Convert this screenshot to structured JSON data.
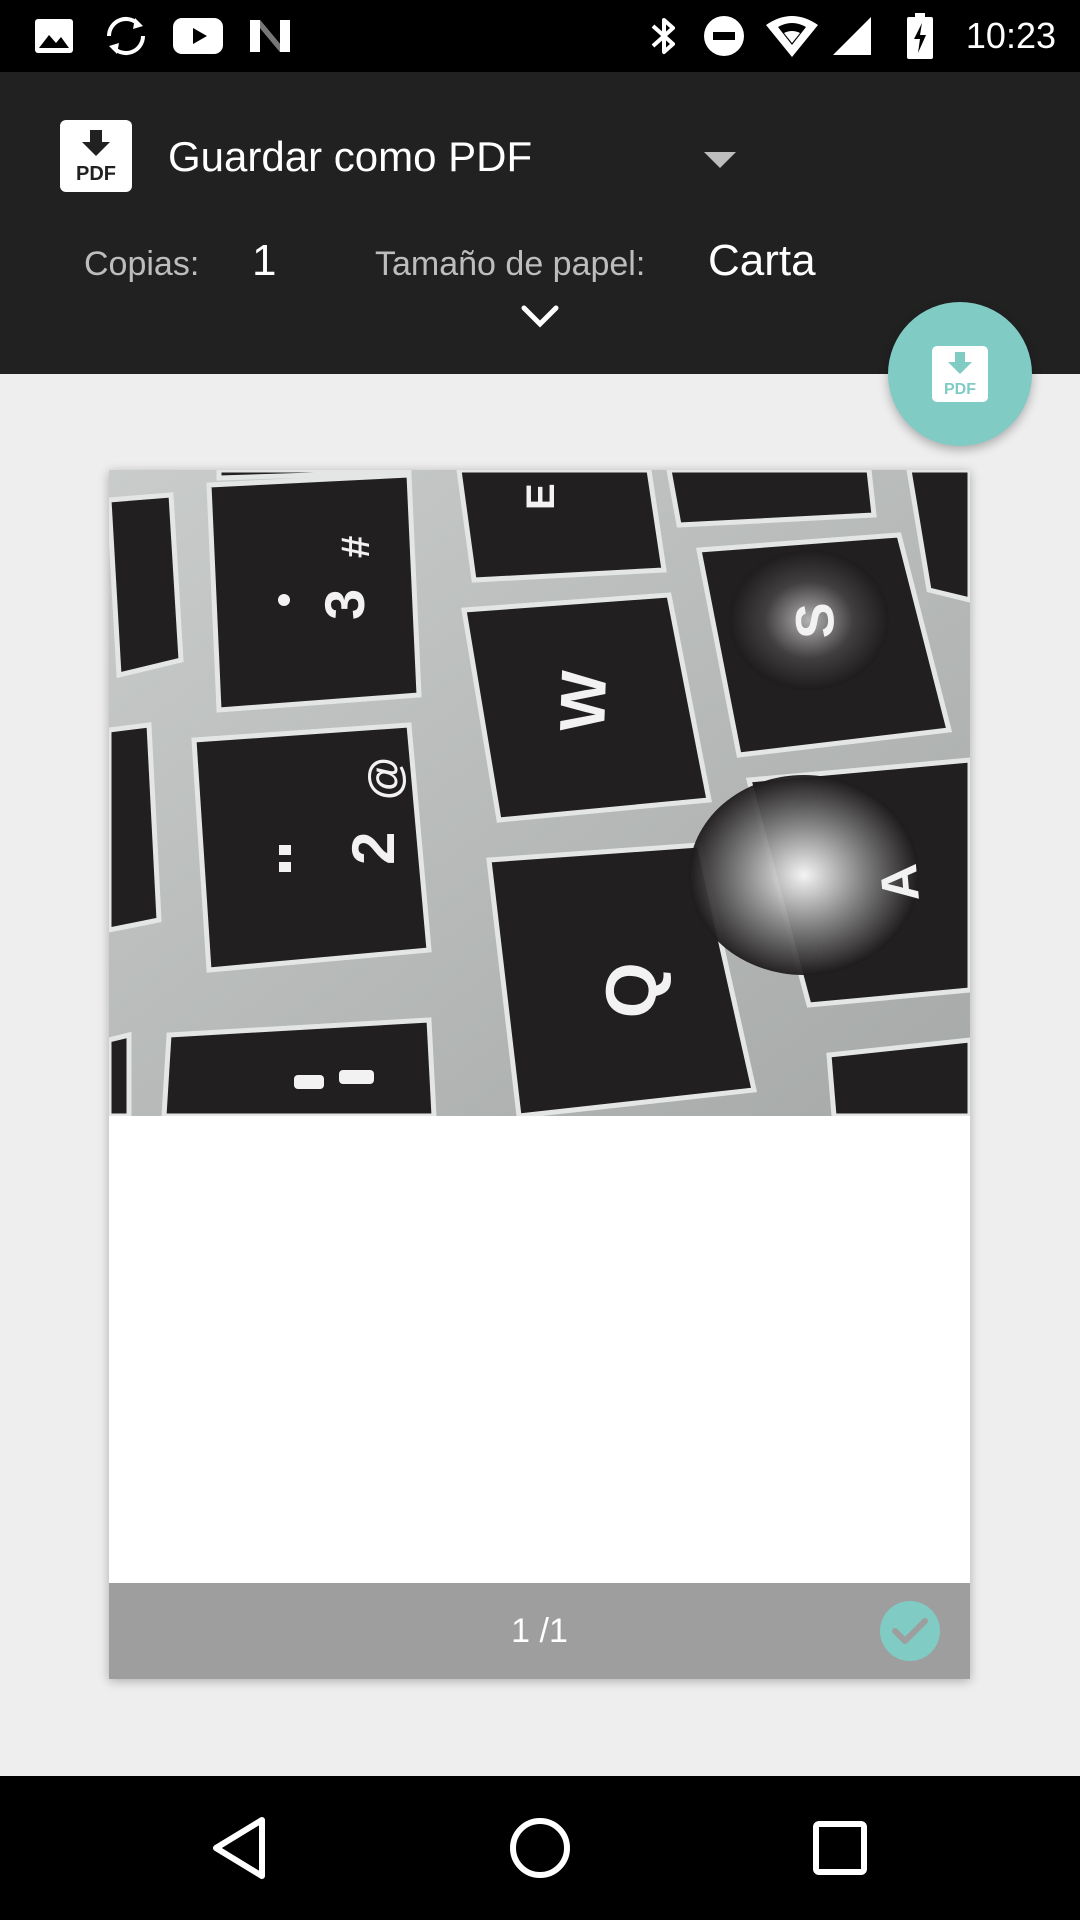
{
  "status_bar": {
    "time": "10:23",
    "left_icons": [
      "image-icon",
      "sync-icon",
      "youtube-icon",
      "n-icon"
    ],
    "right_icons": [
      "bluetooth-icon",
      "do-not-disturb-icon",
      "wifi-icon",
      "signal-icon",
      "battery-charging-icon"
    ]
  },
  "header": {
    "printer_name": "Guardar como PDF",
    "copies_label": "Copias:",
    "copies_value": "1",
    "paper_size_label": "Tamaño de papel:",
    "paper_size_value": "Carta"
  },
  "preview": {
    "page_number": "1 /1",
    "photo_keys": [
      "3 #",
      "E",
      "S",
      "W",
      "2 @",
      "A",
      "Q"
    ]
  },
  "colors": {
    "header_bg": "#212121",
    "accent": "#80cbc4",
    "page_footer": "#9e9e9e",
    "background": "#eeeeee"
  }
}
